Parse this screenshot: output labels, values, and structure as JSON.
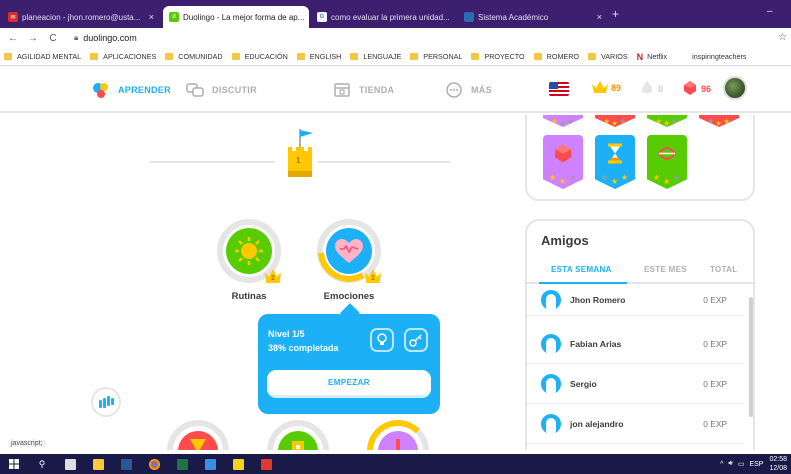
{
  "browser": {
    "tabs": [
      {
        "label": "planeacion - jhon.romero@usta...",
        "close": "×"
      },
      {
        "label": "Duolingo - La mejor forma de ap...",
        "close": "×"
      },
      {
        "label": "como evaluar la primera unidad...",
        "close": "×"
      },
      {
        "label": "Sistema Académico",
        "close": "×"
      }
    ],
    "new_tab": "+",
    "minimize": "–",
    "url": "duolingo.com",
    "bookmarks": [
      "AGILIDAD MENTAL",
      "APLICACIONES",
      "COMUNIDAD",
      "EDUCACIÓN",
      "ENGLISH",
      "LENGUAJE",
      "PERSONAL",
      "PROYECTO",
      "ROMERO",
      "VARIOS",
      "Netflix",
      "inspiringteachers"
    ],
    "netflix_glyph": "N",
    "status_text": "javascript;"
  },
  "nav": {
    "aprender": "APRENDER",
    "discutir": "DISCUTIR",
    "tienda": "TIENDA",
    "mas": "MÁS",
    "streak": "89",
    "lingots": "0",
    "gems": "96"
  },
  "tree": {
    "castle_level": "1",
    "skills": [
      {
        "name": "Rutinas",
        "crown": "2"
      },
      {
        "name": "Emociones",
        "crown": "1"
      }
    ],
    "popup": {
      "level": "Nivel 1/5",
      "progress": "38% completada",
      "start": "EMPEZAR"
    }
  },
  "friends": {
    "title": "Amigos",
    "tabs": [
      "ESTA SEMANA",
      "ESTE MES",
      "TOTAL"
    ],
    "rows": [
      {
        "name": "Jhon Romero",
        "exp": "0 EXP"
      },
      {
        "name": "Fabian Arias",
        "exp": "0 EXP"
      },
      {
        "name": "Sergio",
        "exp": "0 EXP"
      },
      {
        "name": "jon alejandro",
        "exp": "0 EXP"
      }
    ]
  },
  "taskbar": {
    "lang": "ESP",
    "time": "02:58",
    "date": "12/08"
  },
  "colors": {
    "duo_blue": "#1cb0f6",
    "duo_green": "#58cc02",
    "crown_gold": "#ffc800",
    "browser_frame": "#3c1f6e",
    "taskbar": "#1a1a48"
  }
}
